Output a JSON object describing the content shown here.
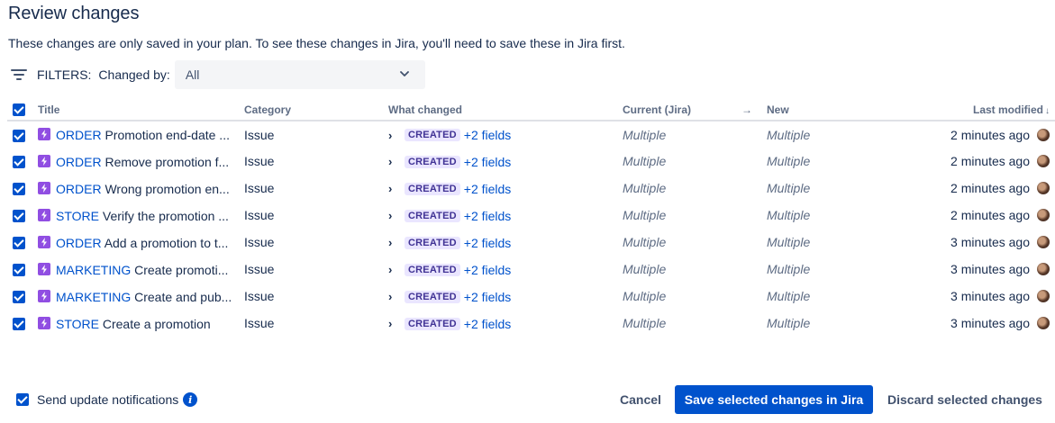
{
  "header": {
    "title": "Review changes",
    "description": "These changes are only saved in your plan. To see these changes in Jira, you'll need to save these in Jira first."
  },
  "filters": {
    "label": "FILTERS:",
    "changed_by_label": "Changed by:",
    "changed_by_value": "All"
  },
  "table": {
    "columns": {
      "title": "Title",
      "category": "Category",
      "what_changed": "What changed",
      "current": "Current (Jira)",
      "arrow": "→",
      "new": "New",
      "last_modified": "Last modified"
    },
    "rows": [
      {
        "project": "ORDER",
        "summary": "Promotion end-date ...",
        "category": "Issue",
        "badge": "CREATED",
        "fields": "+2 fields",
        "current": "Multiple",
        "new": "Multiple",
        "modified": "2 minutes ago"
      },
      {
        "project": "ORDER",
        "summary": "Remove promotion f...",
        "category": "Issue",
        "badge": "CREATED",
        "fields": "+2 fields",
        "current": "Multiple",
        "new": "Multiple",
        "modified": "2 minutes ago"
      },
      {
        "project": "ORDER",
        "summary": "Wrong promotion en...",
        "category": "Issue",
        "badge": "CREATED",
        "fields": "+2 fields",
        "current": "Multiple",
        "new": "Multiple",
        "modified": "2 minutes ago"
      },
      {
        "project": "STORE",
        "summary": "Verify the promotion ...",
        "category": "Issue",
        "badge": "CREATED",
        "fields": "+2 fields",
        "current": "Multiple",
        "new": "Multiple",
        "modified": "2 minutes ago"
      },
      {
        "project": "ORDER",
        "summary": "Add a promotion to t...",
        "category": "Issue",
        "badge": "CREATED",
        "fields": "+2 fields",
        "current": "Multiple",
        "new": "Multiple",
        "modified": "3 minutes ago"
      },
      {
        "project": "MARKETING",
        "summary": "Create promoti...",
        "category": "Issue",
        "badge": "CREATED",
        "fields": "+2 fields",
        "current": "Multiple",
        "new": "Multiple",
        "modified": "3 minutes ago"
      },
      {
        "project": "MARKETING",
        "summary": "Create and pub...",
        "category": "Issue",
        "badge": "CREATED",
        "fields": "+2 fields",
        "current": "Multiple",
        "new": "Multiple",
        "modified": "3 minutes ago"
      },
      {
        "project": "STORE",
        "summary": "Create a promotion",
        "category": "Issue",
        "badge": "CREATED",
        "fields": "+2 fields",
        "current": "Multiple",
        "new": "Multiple",
        "modified": "3 minutes ago"
      }
    ]
  },
  "footer": {
    "notify_label": "Send update notifications",
    "cancel_label": "Cancel",
    "save_label": "Save selected changes in Jira",
    "discard_label": "Discard selected changes"
  },
  "colors": {
    "primary": "#0052cc",
    "issue_icon": "#904ee2",
    "lozenge_bg": "#eae6ff",
    "lozenge_text": "#403294"
  },
  "icons": {
    "filter": "filter-icon",
    "chevron": "chevron-down-icon",
    "issue": "lightning-issue-icon",
    "expand": "chevron-right-icon",
    "info": "info-icon"
  }
}
